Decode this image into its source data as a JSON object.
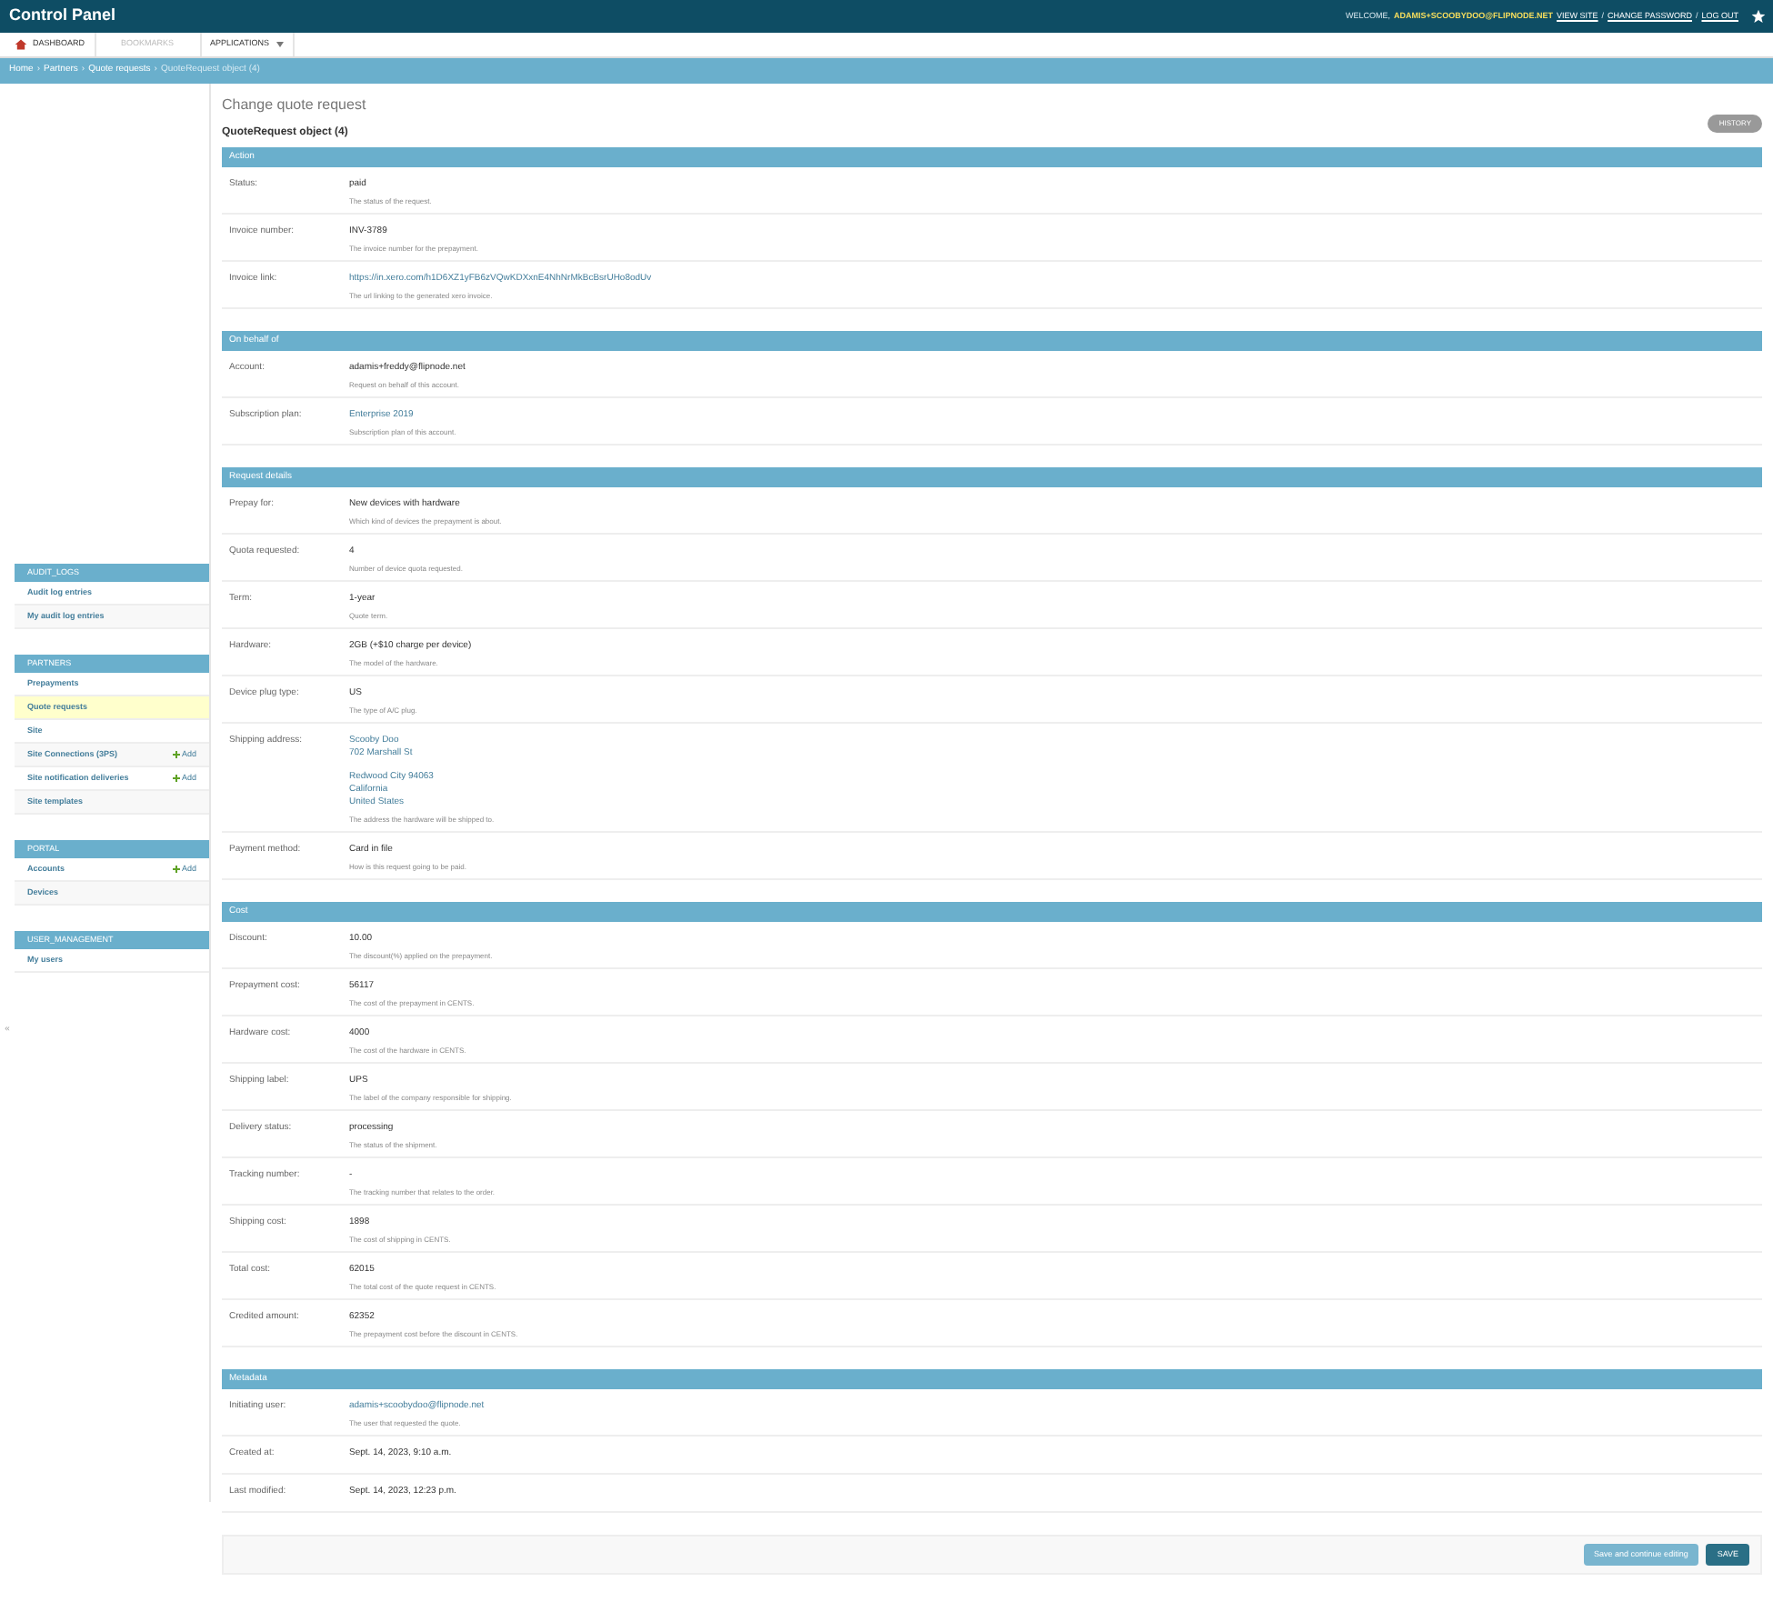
{
  "header": {
    "title": "Control Panel",
    "welcome": "WELCOME,",
    "user": "ADAMIS+SCOOBYDOO@FLIPNODE.NET",
    "links": [
      {
        "label": "VIEW SITE"
      },
      {
        "label": "CHANGE PASSWORD"
      },
      {
        "label": "LOG OUT"
      }
    ],
    "link_separator": "/"
  },
  "nav": [
    {
      "label": "DASHBOARD",
      "kind": "home",
      "disabled": false
    },
    {
      "label": "BOOKMARKS",
      "kind": "plain",
      "disabled": true
    },
    {
      "label": "APPLICATIONS",
      "kind": "dropdown",
      "disabled": false
    }
  ],
  "breadcrumbs": {
    "separator": "›",
    "items": [
      {
        "label": "Home",
        "link": true
      },
      {
        "label": "Partners",
        "link": true
      },
      {
        "label": "Quote requests",
        "link": true
      },
      {
        "label": "QuoteRequest object (4)",
        "link": false
      }
    ]
  },
  "sidebar": {
    "toggle": "«",
    "modules": [
      {
        "title": "AUDIT_LOGS",
        "items": [
          {
            "label": "Audit log entries",
            "selected": false
          },
          {
            "label": "My audit log entries",
            "selected": false
          }
        ]
      },
      {
        "title": "PARTNERS",
        "items": [
          {
            "label": "Prepayments",
            "selected": false
          },
          {
            "label": "Quote requests",
            "selected": true
          },
          {
            "label": "Site",
            "selected": false
          },
          {
            "label": "Site Connections (3PS)",
            "selected": false,
            "add": "Add"
          },
          {
            "label": "Site notification deliveries",
            "selected": false,
            "add": "Add"
          },
          {
            "label": "Site templates",
            "selected": false
          }
        ]
      },
      {
        "title": "PORTAL",
        "items": [
          {
            "label": "Accounts",
            "selected": false,
            "add": "Add"
          },
          {
            "label": "Devices",
            "selected": false
          }
        ]
      },
      {
        "title": "USER_MANAGEMENT",
        "items": [
          {
            "label": "My users",
            "selected": false
          }
        ]
      }
    ]
  },
  "page": {
    "title": "Change quote request",
    "object": "QuoteRequest object (4)",
    "history_button": "HISTORY"
  },
  "fieldsets": [
    {
      "title": "Action",
      "fields": [
        {
          "label": "Status:",
          "kind": "text",
          "value": "paid",
          "help": "The status of the request."
        },
        {
          "label": "Invoice number:",
          "kind": "text",
          "value": "INV-3789",
          "help": "The invoice number for the prepayment."
        },
        {
          "label": "Invoice link:",
          "kind": "link",
          "value": "https://in.xero.com/h1D6XZ1yFB6zVQwKDXxnE4NhNrMkBcBsrUHo8odUv",
          "help": "The url linking to the generated xero invoice."
        }
      ]
    },
    {
      "title": "On behalf of",
      "fields": [
        {
          "label": "Account:",
          "kind": "text",
          "value": "adamis+freddy@flipnode.net",
          "help": "Request on behalf of this account."
        },
        {
          "label": "Subscription plan:",
          "kind": "link",
          "value": "Enterprise 2019",
          "help": "Subscription plan of this account."
        }
      ]
    },
    {
      "title": "Request details",
      "fields": [
        {
          "label": "Prepay for:",
          "kind": "text",
          "value": "New devices with hardware",
          "help": "Which kind of devices the prepayment is about."
        },
        {
          "label": "Quota requested:",
          "kind": "text",
          "value": "4",
          "help": "Number of device quota requested."
        },
        {
          "label": "Term:",
          "kind": "text",
          "value": "1-year",
          "help": "Quote term."
        },
        {
          "label": "Hardware:",
          "kind": "text",
          "value": "2GB (+$10 charge per device)",
          "help": "The model of the hardware."
        },
        {
          "label": "Device plug type:",
          "kind": "text",
          "value": "US",
          "help": "The type of A/C plug."
        },
        {
          "label": "Shipping address:",
          "kind": "address",
          "blocks": [
            [
              "Scooby Doo",
              "702 Marshall St"
            ],
            [
              "Redwood City 94063",
              "California",
              "United States"
            ]
          ],
          "help": "The address the hardware will be shipped to."
        },
        {
          "label": "Payment method:",
          "kind": "text",
          "value": "Card in file",
          "help": "How is this request going to be paid."
        }
      ]
    },
    {
      "title": "Cost",
      "fields": [
        {
          "label": "Discount:",
          "kind": "text",
          "value": "10.00",
          "help": "The discount(%) applied on the prepayment."
        },
        {
          "label": "Prepayment cost:",
          "kind": "text",
          "value": "56117",
          "help": "The cost of the prepayment in CENTS."
        },
        {
          "label": "Hardware cost:",
          "kind": "text",
          "value": "4000",
          "help": "The cost of the hardware in CENTS."
        },
        {
          "label": "Shipping label:",
          "kind": "text",
          "value": "UPS",
          "help": "The label of the company responsible for shipping."
        },
        {
          "label": "Delivery status:",
          "kind": "text",
          "value": "processing",
          "help": "The status of the shipment."
        },
        {
          "label": "Tracking number:",
          "kind": "text",
          "value": "-",
          "help": "The tracking number that relates to the order."
        },
        {
          "label": "Shipping cost:",
          "kind": "text",
          "value": "1898",
          "help": "The cost of shipping in CENTS."
        },
        {
          "label": "Total cost:",
          "kind": "text",
          "value": "62015",
          "help": "The total cost of the quote request in CENTS."
        },
        {
          "label": "Credited amount:",
          "kind": "text",
          "value": "62352",
          "help": "The prepayment cost before the discount in CENTS."
        }
      ]
    },
    {
      "title": "Metadata",
      "fields": [
        {
          "label": "Initiating user:",
          "kind": "link",
          "value": "adamis+scoobydoo@flipnode.net",
          "help": "The user that requested the quote."
        },
        {
          "label": "Created at:",
          "kind": "text",
          "value": "Sept. 14, 2023, 9:10 a.m."
        },
        {
          "label": "Last modified:",
          "kind": "text",
          "value": "Sept. 14, 2023, 12:23 p.m."
        }
      ]
    }
  ],
  "submit": [
    {
      "label": "Save and continue editing",
      "kind": "secondary"
    },
    {
      "label": "SAVE",
      "kind": "primary"
    }
  ]
}
